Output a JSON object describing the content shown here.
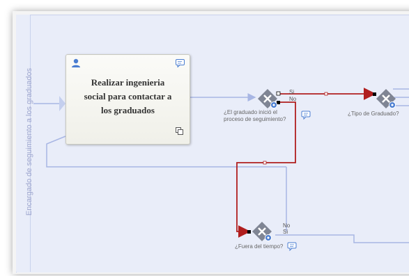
{
  "lane": {
    "title": "Encargado de seguimiento a los graduados"
  },
  "task": {
    "label_line1": "Realizar ingenieria",
    "label_line2": "social para contactar a",
    "label_line3": "los graduados"
  },
  "gateways": {
    "g1": {
      "label_line1": "¿El graduado inició el",
      "label_line2": "proceso de seguimiento?",
      "branch_yes": "Si",
      "branch_no": "No"
    },
    "g2": {
      "label": "¿Tipo de Graduado?"
    },
    "g3": {
      "label": "¿Fuera del tiempo?",
      "branch_no": "No",
      "branch_yes": "Si"
    }
  },
  "colors": {
    "lane_bg": "#e9edf9",
    "flow_line": "#a8b6e4",
    "selected_flow": "#b01e1e",
    "gateway": "#7f8594",
    "task_bg": "#f5f5ef",
    "accent_blue": "#4a7dd1"
  },
  "icons": [
    "user-icon",
    "comment-icon",
    "subprocess-icon",
    "gateway-exclusive-icon",
    "gear-badge-icon"
  ]
}
